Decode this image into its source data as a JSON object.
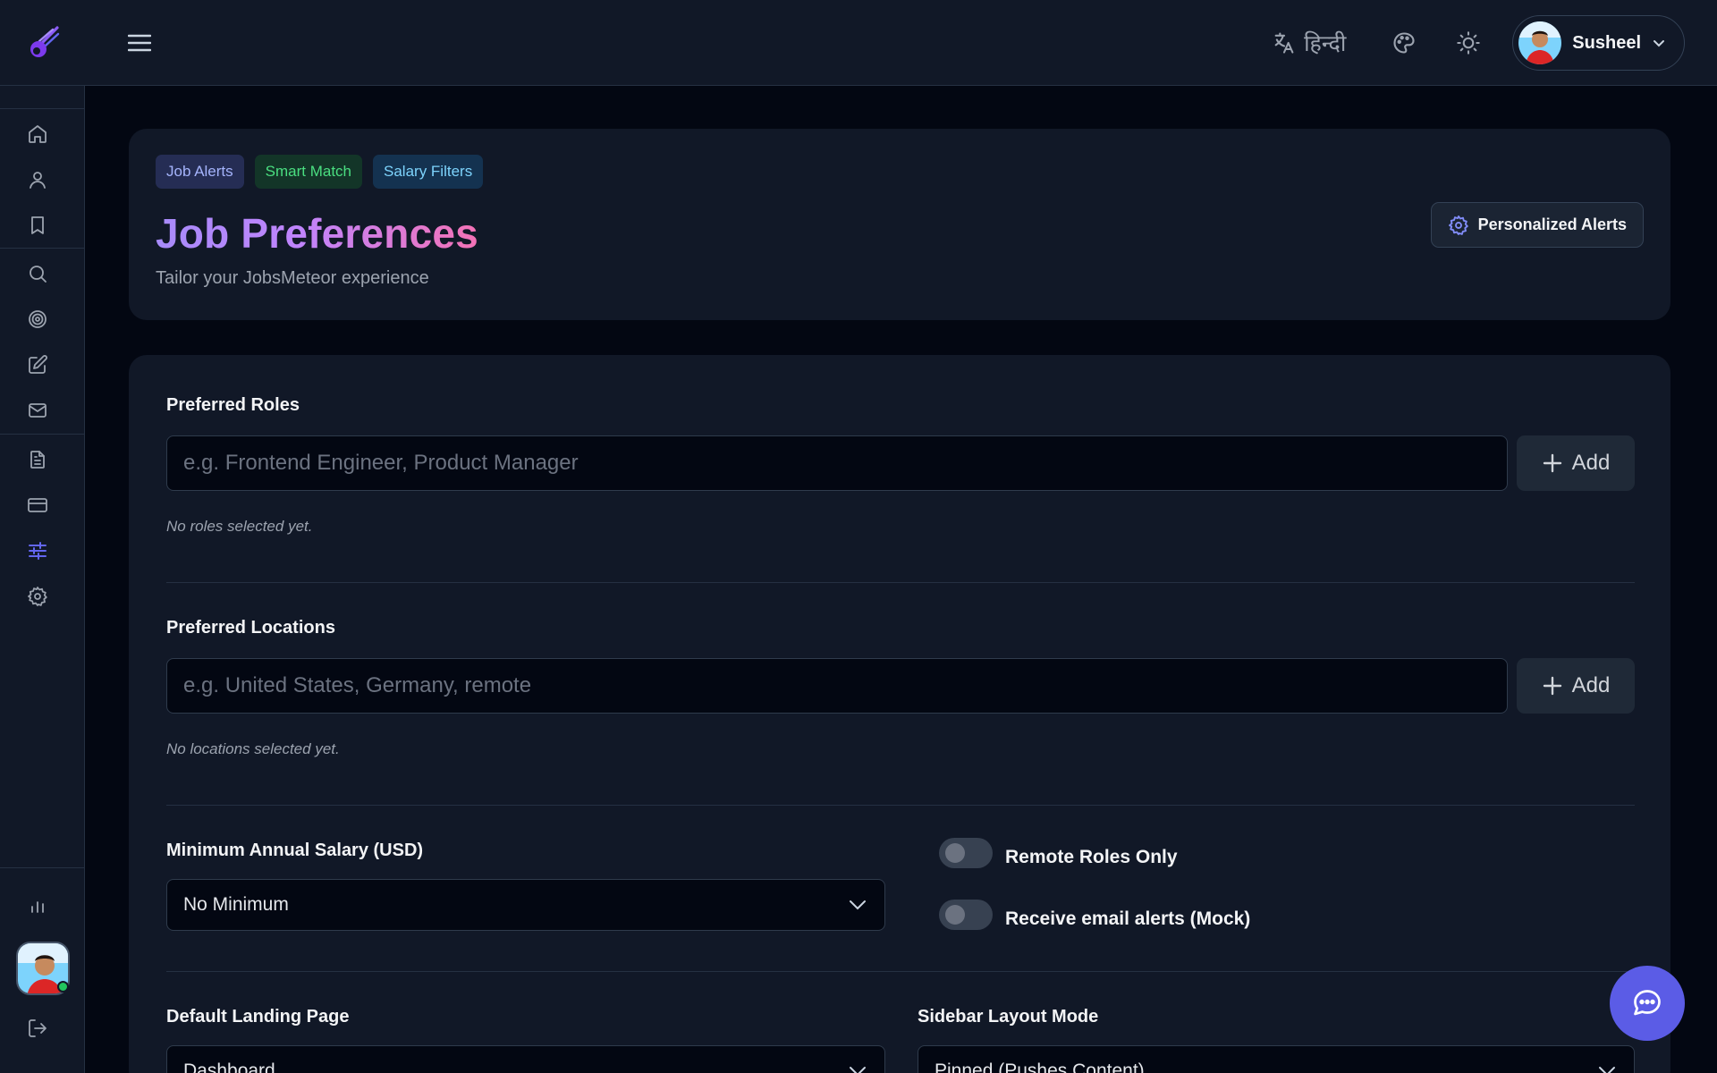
{
  "header": {
    "language_label": "हिन्दी",
    "user_name": "Susheel"
  },
  "hero": {
    "tags": [
      "Job Alerts",
      "Smart Match",
      "Salary Filters"
    ],
    "title": "Job Preferences",
    "subtitle": "Tailor your JobsMeteor experience",
    "alerts_button": "Personalized Alerts"
  },
  "form": {
    "roles": {
      "label": "Preferred Roles",
      "placeholder": "e.g. Frontend Engineer, Product Manager",
      "add_label": "Add",
      "empty": "No roles selected yet."
    },
    "locations": {
      "label": "Preferred Locations",
      "placeholder": "e.g. United States, Germany, remote",
      "add_label": "Add",
      "empty": "No locations selected yet."
    },
    "salary": {
      "label": "Minimum Annual Salary (USD)",
      "value": "No Minimum"
    },
    "remote_toggle": {
      "label": "Remote Roles Only",
      "on": false
    },
    "email_toggle": {
      "label": "Receive email alerts (Mock)",
      "on": false
    },
    "landing": {
      "label": "Default Landing Page",
      "value": "Dashboard"
    },
    "sidebar_mode": {
      "label": "Sidebar Layout Mode",
      "value": "Pinned (Pushes Content)"
    }
  },
  "sidebar": {
    "items": [
      "home-icon",
      "user-icon",
      "bookmark-icon",
      "search-icon",
      "target-icon",
      "edit-icon",
      "mail-icon",
      "document-icon",
      "credit-card-icon",
      "sliders-icon",
      "settings-icon",
      "bar-chart-icon",
      "logout-icon"
    ],
    "active": "sliders-icon"
  },
  "colors": {
    "accent": "#5b5ce6",
    "background": "#030712",
    "panel": "#111827"
  }
}
